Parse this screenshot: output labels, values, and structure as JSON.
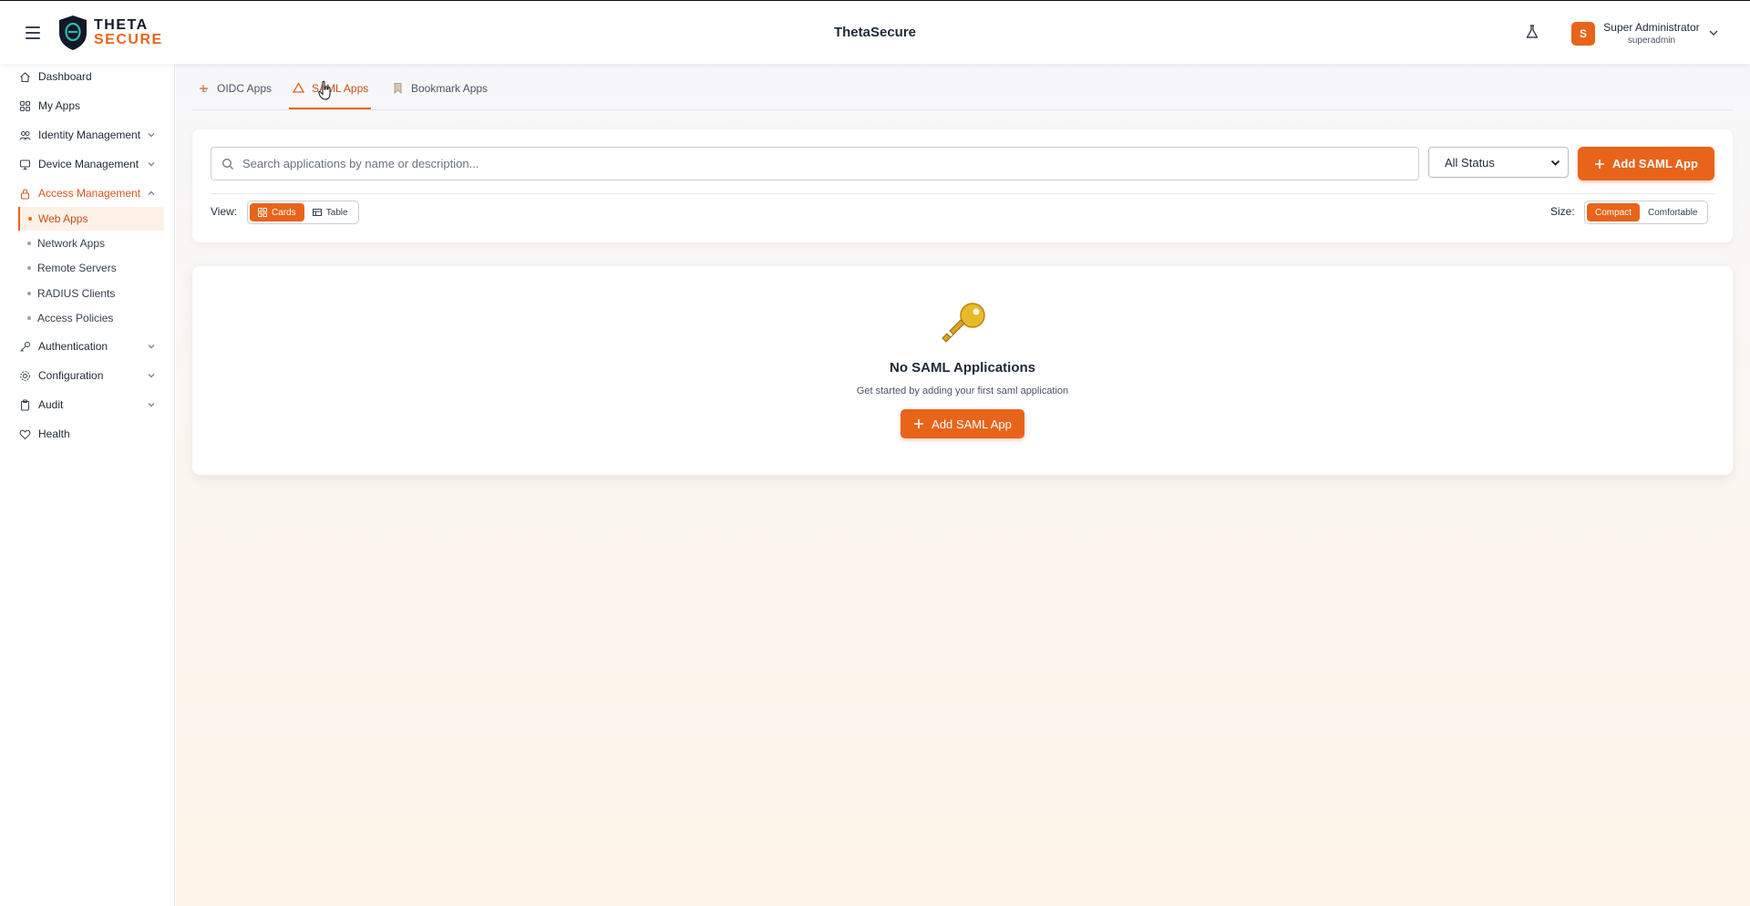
{
  "header": {
    "brand_line1": "THETA",
    "brand_line2": "SECURE",
    "app_title": "ThetaSecure",
    "user": {
      "avatar_initial": "S",
      "name": "Super Administrator",
      "login": "superadmin"
    },
    "icons": [
      "hamburger-icon",
      "shield-logo",
      "flask-icon",
      "chevron-down-icon"
    ]
  },
  "sidebar": {
    "items": [
      {
        "label": "Dashboard",
        "icon": "home-icon"
      },
      {
        "label": "My Apps",
        "icon": "grid-icon"
      },
      {
        "label": "Identity Management",
        "icon": "users-icon",
        "expandable": true
      },
      {
        "label": "Device Management",
        "icon": "monitor-icon",
        "expandable": true
      },
      {
        "label": "Access Management",
        "icon": "lock-icon",
        "expandable": true,
        "expanded": true
      },
      {
        "label": "Authentication",
        "icon": "key-icon",
        "expandable": true
      },
      {
        "label": "Configuration",
        "icon": "gear-icon",
        "expandable": true
      },
      {
        "label": "Audit",
        "icon": "clipboard-icon",
        "expandable": true
      },
      {
        "label": "Health",
        "icon": "heart-icon"
      }
    ],
    "access_management_children": [
      {
        "label": "Web Apps",
        "active": true
      },
      {
        "label": "Network Apps"
      },
      {
        "label": "Remote Servers"
      },
      {
        "label": "RADIUS Clients"
      },
      {
        "label": "Access Policies"
      }
    ]
  },
  "tabs": [
    {
      "label": "OIDC Apps",
      "icon": "oidc-icon"
    },
    {
      "label": "SAML Apps",
      "icon": "triangle-icon",
      "active": true
    },
    {
      "label": "Bookmark Apps",
      "icon": "bookmark-icon"
    }
  ],
  "toolbar": {
    "search_placeholder": "Search applications by name or description...",
    "status_filter": "All Status",
    "add_button": "Add SAML App",
    "view_label": "View:",
    "view_options": [
      "Cards",
      "Table"
    ],
    "view_selected": "Cards",
    "size_label": "Size:",
    "size_options": [
      "Compact",
      "Comfortable"
    ],
    "size_selected": "Compact"
  },
  "empty_state": {
    "icon": "key-icon",
    "title": "No SAML Applications",
    "subtitle": "Get started by adding your first saml application",
    "button": "Add SAML App"
  },
  "colors": {
    "accent": "#e8641a",
    "accent_dark": "#c8501a"
  }
}
